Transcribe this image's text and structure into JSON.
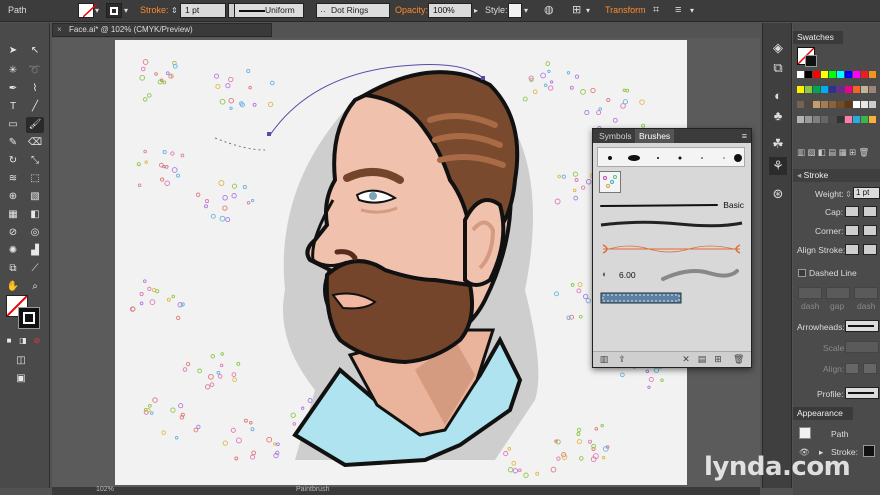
{
  "control_bar": {
    "selection_type": "Path",
    "stroke_label": "Stroke:",
    "stroke_weight": "1 pt",
    "profile": "Uniform",
    "brush": "Dot Rings",
    "opacity_label": "Opacity:",
    "opacity_value": "100%",
    "style_label": "Style:",
    "transform_label": "Transform"
  },
  "document": {
    "tab_title": "Face.ai* @ 102% (CMYK/Preview)"
  },
  "brushes_panel": {
    "tabs": [
      {
        "label": "Symbols"
      },
      {
        "label": "Brushes"
      }
    ],
    "basic_label": "Basic",
    "bristle_size": "6.00"
  },
  "right_panel": {
    "swatches_title": "Swatches",
    "stroke_title": "Stroke",
    "weight_label": "Weight:",
    "weight_value": "1 pt",
    "cap_label": "Cap:",
    "corner_label": "Corner:",
    "align_stroke_label": "Align Stroke:",
    "dashed_line_label": "Dashed Line",
    "dash_labels": [
      "dash",
      "gap",
      "dash"
    ],
    "arrowheads_label": "Arrowheads:",
    "scale_label": "Scale:",
    "align_label": "Align:",
    "profile_label": "Profile:",
    "appearance_title": "Appearance",
    "appearance_item": "Path",
    "appearance_stroke": "Stroke:"
  },
  "status_bar": {
    "zoom": "102%",
    "tool_name": "Paintbrush"
  },
  "watermark": "lynda.com",
  "colors": {
    "skin": "#f0c2ad",
    "skin_shadow": "#d59b80",
    "hair": "#7a4a2e",
    "beard": "#74452b",
    "shirt": "#aee3ef",
    "accent_orange": "#ff8a2b",
    "selection_path": "#5a4aa8"
  },
  "swatch_colors": [
    "#ffffff",
    "#000000",
    "#ff0000",
    "#ffff00",
    "#00ff00",
    "#00ffff",
    "#0000ff",
    "#ff00ff",
    "#ed1c24",
    "#f7941d",
    "#fff200",
    "#8dc63f",
    "#00a651",
    "#00aeef",
    "#2e3192",
    "#662d91",
    "#ec008c",
    "#f26522",
    "#c7b299",
    "#998675",
    "#736357",
    "#534741",
    "#c69c6d",
    "#a67c52",
    "#8c6239",
    "#754c24",
    "#603913",
    "#ffffff",
    "#e6e6e6",
    "#cccccc",
    "#b3b3b3",
    "#999999",
    "#808080",
    "#666666",
    "#4d4d4d",
    "#333333",
    "#ff7bac",
    "#29abe2",
    "#39b54a",
    "#fbb03b"
  ]
}
